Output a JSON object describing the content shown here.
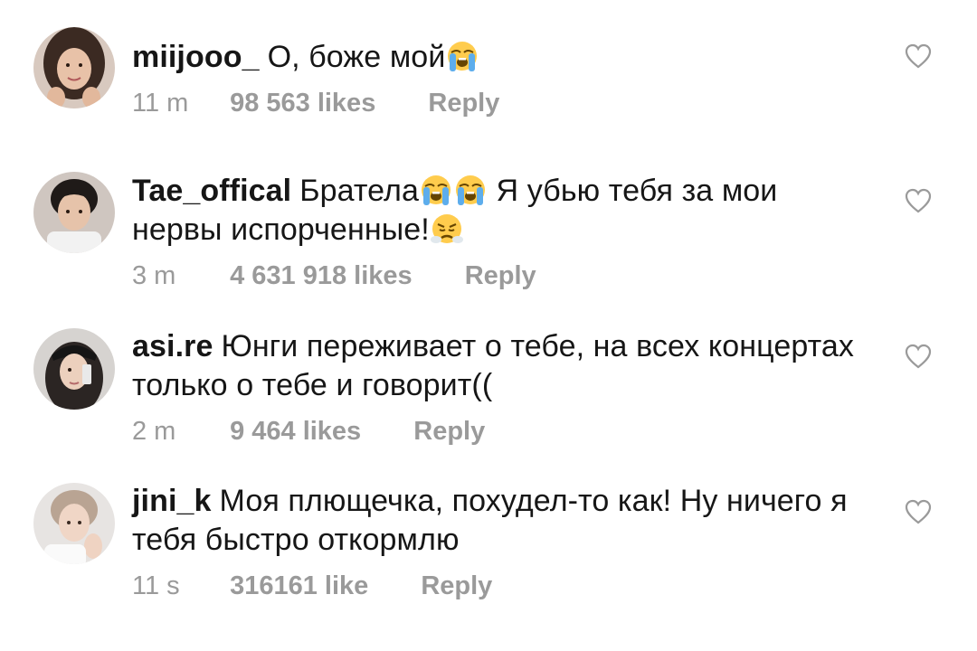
{
  "comments": [
    {
      "username": "miijooo_",
      "text": "О, боже мой",
      "time": "11 m",
      "likes": "98 563 likes",
      "reply": "Reply",
      "avatar_icon": "avatar-girl-dark-hair",
      "emojis": [
        "loudly-crying-face"
      ]
    },
    {
      "username": "Tae_offical",
      "text_a": "Братела",
      "text_b": " Я убью тебя за мои нервы испорченные!",
      "time": "3 m",
      "likes": "4 631 918 likes",
      "reply": "Reply",
      "avatar_icon": "avatar-boy-dark-hair",
      "emojis": [
        "loudly-crying-face",
        "loudly-crying-face",
        "face-with-steam"
      ]
    },
    {
      "username": "asi.re",
      "text": "Юнги переживает о тебе, на всех концертах только о тебе и говорит((",
      "time": "2 m",
      "likes": "9 464 likes",
      "reply": "Reply",
      "avatar_icon": "avatar-girl-cap"
    },
    {
      "username": "jini_k",
      "text": "Моя плющечка, похудел-то как! Ну ничего я тебя быстро откормлю",
      "time": "11 s",
      "likes": "316161 like",
      "reply": "Reply",
      "avatar_icon": "avatar-boy-light-hair"
    }
  ],
  "colors": {
    "text": "#161616",
    "meta": "#9a9a9a",
    "heart": "#9a9a9a",
    "background": "#ffffff"
  }
}
